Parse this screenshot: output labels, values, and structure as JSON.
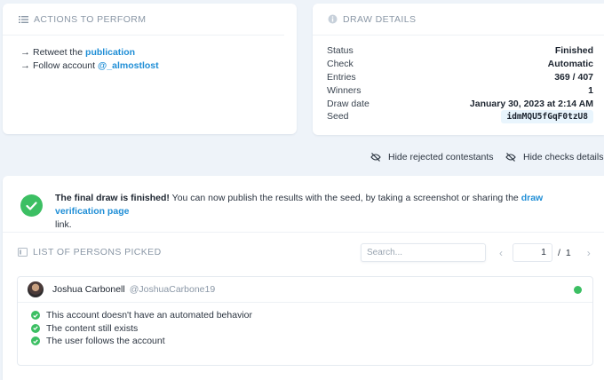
{
  "actions": {
    "title": "ACTIONS TO PERFORM",
    "items": [
      {
        "prefix": "Retweet the",
        "link": "publication"
      },
      {
        "prefix": "Follow account",
        "link": "@_almostlost"
      }
    ]
  },
  "details": {
    "title": "DRAW DETAILS",
    "rows": [
      {
        "label": "Status",
        "value": "Finished"
      },
      {
        "label": "Check",
        "value": "Automatic"
      },
      {
        "label": "Entries",
        "value": "369 / 407"
      },
      {
        "label": "Winners",
        "value": "1"
      },
      {
        "label": "Draw date",
        "value": "January 30, 2023 at 2:14 AM"
      }
    ],
    "seed_label": "Seed",
    "seed_value": "idmMQU5fGqF0tzU8"
  },
  "toggles": {
    "hide_rejected": "Hide rejected contestants",
    "hide_checks": "Hide checks details"
  },
  "notice": {
    "bold": "The final draw is finished!",
    "text": " You can now publish the results with the seed, by taking a screenshot or sharing the ",
    "link": "draw verification page",
    "tail": "link."
  },
  "list": {
    "title": "LIST OF PERSONS PICKED",
    "search_placeholder": "Search...",
    "page_current": "1",
    "page_total": "1"
  },
  "person": {
    "name": "Joshua Carbonell",
    "handle": "@JoshuaCarbone19",
    "checks": [
      "This account doesn't have an automated behavior",
      "The content still exists",
      "The user follows the account"
    ]
  },
  "colors": {
    "accent": "#1f8ed6",
    "success": "#3cbf63",
    "background": "#eef3f9"
  }
}
